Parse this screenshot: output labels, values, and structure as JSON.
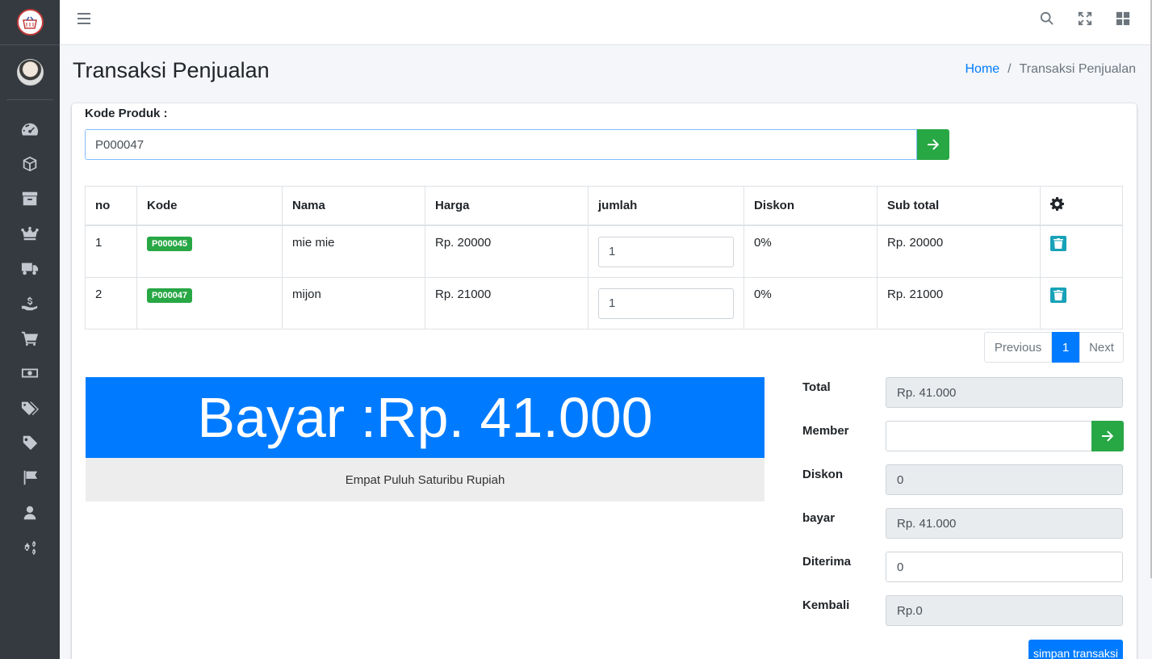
{
  "header": {
    "page_title": "Transaksi Penjualan",
    "breadcrumb": {
      "home": "Home",
      "separator": "/",
      "current": "Transaksi Penjualan"
    }
  },
  "navbar": {
    "icons": [
      "menu-icon",
      "search-icon",
      "fullscreen-icon",
      "apps-icon"
    ]
  },
  "sidebar": {
    "icons": [
      "dashboard-icon",
      "box-icon",
      "archive-icon",
      "crown-icon",
      "truck-icon",
      "money-hand-icon",
      "cart-icon",
      "money-bill-icon",
      "tags-icon",
      "tag-icon",
      "flag-icon",
      "user-icon",
      "cogs-icon"
    ]
  },
  "product_form": {
    "label": "Kode Produk :",
    "value": "P000047"
  },
  "table": {
    "headers": [
      "no",
      "Kode",
      "Nama",
      "Harga",
      "jumlah",
      "Diskon",
      "Sub total"
    ],
    "rows": [
      {
        "no": "1",
        "kode": "P000045",
        "nama": "mie mie",
        "harga": "Rp. 20000",
        "jumlah": "1",
        "diskon": "0%",
        "subtotal": "Rp. 20000"
      },
      {
        "no": "2",
        "kode": "P000047",
        "nama": "mijon",
        "harga": "Rp. 21000",
        "jumlah": "1",
        "diskon": "0%",
        "subtotal": "Rp. 21000"
      }
    ]
  },
  "pagination": {
    "previous": "Previous",
    "current": "1",
    "next": "Next"
  },
  "bayar": {
    "display": "Bayar :Rp. 41.000",
    "terbilang": "Empat Puluh Saturibu Rupiah"
  },
  "summary": {
    "total_label": "Total",
    "total_value": "Rp. 41.000",
    "member_label": "Member",
    "member_value": "",
    "diskon_label": "Diskon",
    "diskon_value": "0",
    "bayar_label": "bayar",
    "bayar_value": "Rp. 41.000",
    "diterima_label": "Diterima",
    "diterima_value": "0",
    "kembali_label": "Kembali",
    "kembali_value": "Rp.0",
    "save_label": "simpan transaksi"
  },
  "colors": {
    "primary": "#007bff",
    "success": "#28a745",
    "info": "#17a2b8",
    "sidebar": "#343a40"
  }
}
